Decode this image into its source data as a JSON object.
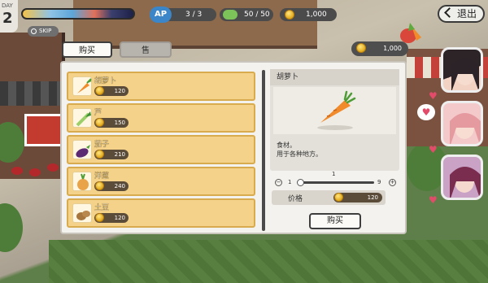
{
  "hud": {
    "day_label": "DAY",
    "day_number": "2",
    "skip_label": "SKIP",
    "ap_tag": "AP",
    "ap_value": "3 / 3",
    "stamina_value": "50 / 50",
    "gold_value": "1,000",
    "exit_label": "退出"
  },
  "shop": {
    "gold_value": "1,000",
    "tabs": [
      "购买",
      "售"
    ],
    "active_tab": "购买",
    "items": [
      {
        "name": "胡萝卜",
        "price": "120",
        "icon": "carrot-icon"
      },
      {
        "name": "芦",
        "price": "150",
        "icon": "leek-icon"
      },
      {
        "name": "茄子",
        "price": "210",
        "icon": "eggplant-icon"
      },
      {
        "name": "洋葱",
        "price": "240",
        "icon": "onion-icon"
      },
      {
        "name": "土豆",
        "price": "120",
        "icon": "potato-icon"
      }
    ],
    "detail": {
      "title": "胡萝卜",
      "desc_line1": "食材。",
      "desc_line2": "用于各种地方。",
      "qty_current": "1",
      "qty_min": "1",
      "qty_max": "9",
      "price_label": "价格",
      "price_value": "120",
      "buy_label": "购买"
    }
  },
  "colors": {
    "item_bg": "#f5d289",
    "item_border": "#d9ab4f",
    "panel_bg": "#f4f2ee",
    "heart": "#e24b6a"
  }
}
